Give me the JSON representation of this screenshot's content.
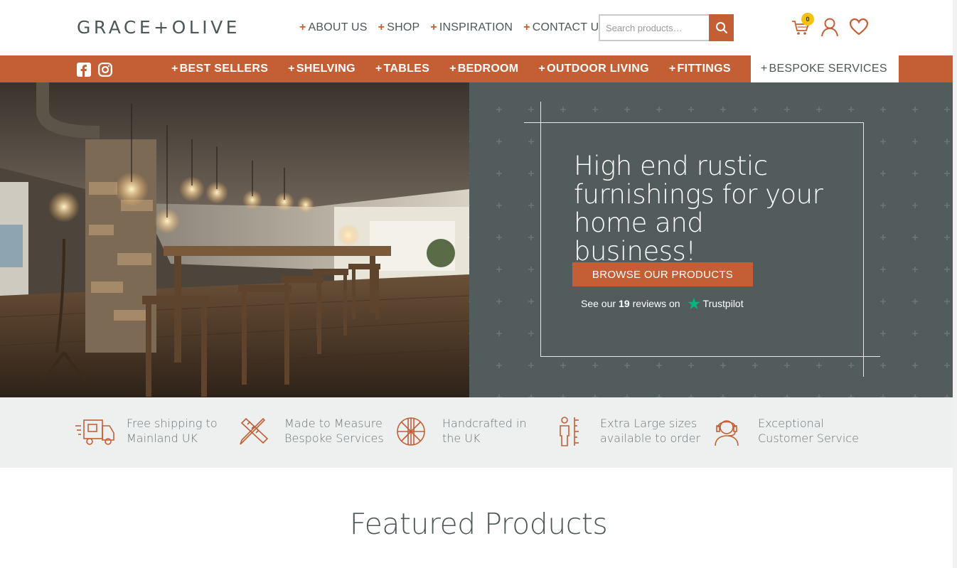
{
  "header": {
    "logo": "GRACE+OLIVE",
    "nav": [
      {
        "label": "ABOUT US"
      },
      {
        "label": "SHOP"
      },
      {
        "label": "INSPIRATION"
      },
      {
        "label": "CONTACT US"
      }
    ],
    "search": {
      "placeholder": "Search products…"
    },
    "cart_count": "0",
    "icons": [
      "search-icon",
      "cart-icon",
      "account-icon",
      "wishlist-heart-icon"
    ]
  },
  "categories": {
    "social": [
      "facebook-icon",
      "instagram-icon"
    ],
    "items": [
      {
        "label": "BEST SELLERS"
      },
      {
        "label": "SHELVING"
      },
      {
        "label": "TABLES"
      },
      {
        "label": "BEDROOM"
      },
      {
        "label": "OUTDOOR LIVING"
      },
      {
        "label": "FITTINGS"
      },
      {
        "label": "BESPOKE SERVICES"
      }
    ]
  },
  "hero": {
    "title": "High end rustic furnishings for your home and business!",
    "button": "BROWSE OUR PRODUCTS",
    "trust_prefix": "See our",
    "trust_count": "19",
    "trust_suffix": "reviews on",
    "trust_brand": "Trustpilot"
  },
  "features": [
    {
      "icon": "delivery-truck-icon",
      "line1": "Free shipping to",
      "line2": "Mainland UK"
    },
    {
      "icon": "ruler-pencil-icon",
      "line1": "Made to Measure",
      "line2": "Bespoke Services"
    },
    {
      "icon": "uk-flag-icon",
      "line1": "Handcrafted in",
      "line2": "the UK"
    },
    {
      "icon": "size-measure-icon",
      "line1": "Extra Large sizes",
      "line2": "available to order"
    },
    {
      "icon": "headset-icon",
      "line1": "Exceptional",
      "line2": "Customer Service"
    }
  ],
  "featured": {
    "title": "Featured Products"
  },
  "colors": {
    "accent": "#c45f35",
    "panel": "#525c5d",
    "text": "#4d5658",
    "features_bg": "#eef0f0"
  }
}
